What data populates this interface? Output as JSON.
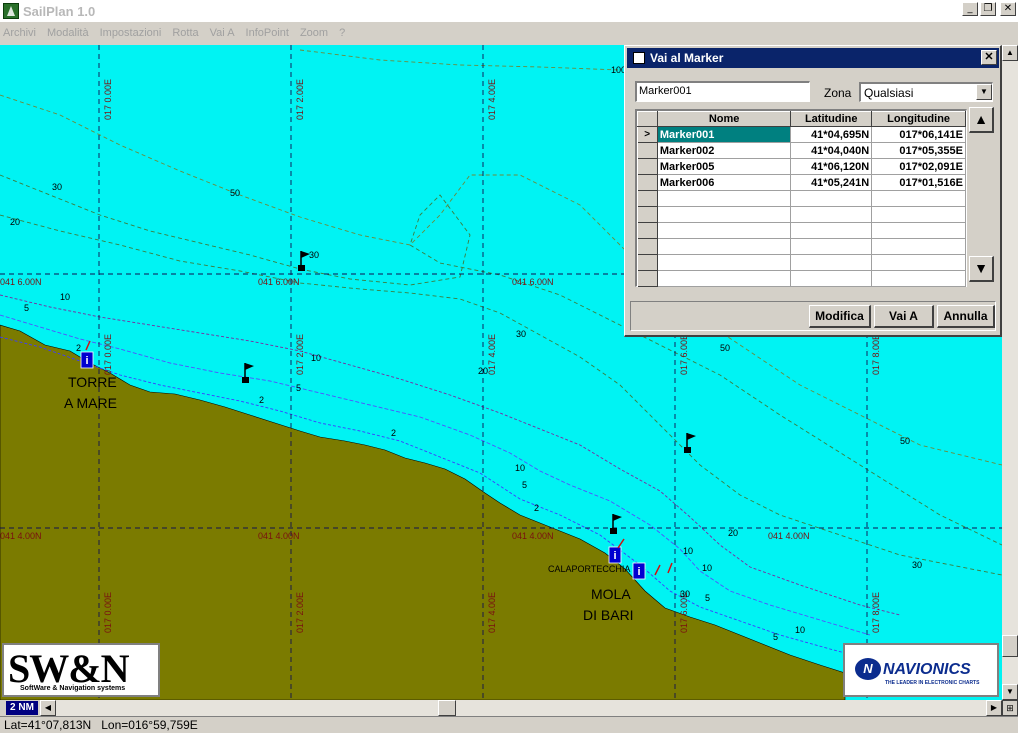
{
  "window": {
    "title": "SailPlan 1.0",
    "min_glyph": "_",
    "restore_glyph": "❐",
    "close_glyph": "✕"
  },
  "menu": [
    "Archivi",
    "Modalità",
    "Impostazioni",
    "Rotta",
    "Vai A",
    "InfoPoint",
    "Zoom",
    "?"
  ],
  "map": {
    "colors": {
      "sea": "#00f3f3",
      "land": "#7b7b00"
    },
    "grid_labels": {
      "lat_6": "041 6.00N",
      "lat_4": "041 4.00N",
      "lon_0": "017 0.00E",
      "lon_2": "017 2.00E",
      "lon_4": "017 4.00E",
      "lon_6": "017 6.00E",
      "lon_8": "017 8.00E"
    },
    "depths": [
      "100",
      "30",
      "50",
      "20",
      "10",
      "5",
      "2",
      "30",
      "30",
      "50",
      "50",
      "20",
      "30",
      "10",
      "5",
      "2",
      "2",
      "5",
      "10",
      "20",
      "10",
      "5",
      "10",
      "5",
      "30",
      "50",
      "2",
      "10",
      "30"
    ],
    "places": {
      "torre_line1": "TORRE",
      "torre_line2": "A MARE",
      "calaportecchia": "CALAPORTECCHIA",
      "mola_line1": "MOLA",
      "mola_line2": "DI BARI"
    },
    "info_icon_glyph": "i"
  },
  "logos": {
    "swn_title": "SW&N",
    "swn_subtitle": "SoftWare & Navigation systems",
    "navionics_mark": "N",
    "navionics_name": "NAVIONICS",
    "navionics_tagline": "THE LEADER IN ELECTRONIC CHARTS"
  },
  "dialog": {
    "title": "Vai al Marker",
    "close_glyph": "✕",
    "search_value": "Marker001",
    "zona_label": "Zona",
    "zona_value": "Qualsiasi",
    "columns": [
      "Nome",
      "Latitudine",
      "Longitudine"
    ],
    "rows": [
      {
        "nome": "Marker001",
        "lat": "41*04,695N",
        "lon": "017*06,141E",
        "indicator": ">"
      },
      {
        "nome": "Marker002",
        "lat": "41*04,040N",
        "lon": "017*05,355E",
        "indicator": ""
      },
      {
        "nome": "Marker005",
        "lat": "41*06,120N",
        "lon": "017*02,091E",
        "indicator": ""
      },
      {
        "nome": "Marker006",
        "lat": "41*05,241N",
        "lon": "017*01,516E",
        "indicator": ""
      }
    ],
    "up_glyph": "▲",
    "down_glyph": "▼",
    "buttons": {
      "modifica": "Modifica",
      "vai_a": "Vai A",
      "annulla": "Annulla"
    }
  },
  "scale": "2 NM",
  "status": {
    "lat": "Lat=41°07,813N",
    "lon": "Lon=016°59,759E"
  },
  "scroll": {
    "left": "◀",
    "right": "▶",
    "up": "▲",
    "down": "▼",
    "corner": "⊞"
  }
}
